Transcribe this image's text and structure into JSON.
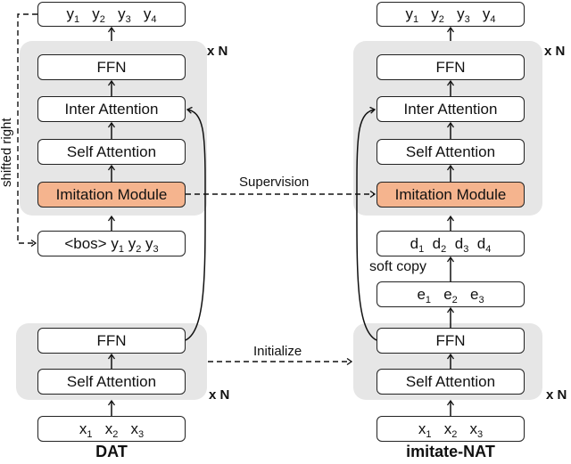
{
  "colors": {
    "panel_bg": "#e6e6e6",
    "imitation_module": "#f5b48e",
    "stroke": "#222222"
  },
  "left": {
    "title": "DAT",
    "output_tokens": [
      [
        "y",
        "1"
      ],
      [
        "y",
        "2"
      ],
      [
        "y",
        "3"
      ],
      [
        "y",
        "4"
      ]
    ],
    "decoder": {
      "repeat": "x N",
      "ffn": "FFN",
      "inter_attention": "Inter Attention",
      "self_attention": "Self Attention",
      "imitation_module": "Imitation Module"
    },
    "decoder_input": {
      "bos": "<bos>",
      "tokens": [
        [
          "y",
          "1"
        ],
        [
          "y",
          "2"
        ],
        [
          "y",
          "3"
        ]
      ]
    },
    "encoder": {
      "repeat": "x N",
      "ffn": "FFN",
      "self_attention": "Self Attention"
    },
    "input_tokens": [
      [
        "x",
        "1"
      ],
      [
        "x",
        "2"
      ],
      [
        "x",
        "3"
      ]
    ],
    "shifted_label": "shifted right"
  },
  "right": {
    "title": "imitate-NAT",
    "output_tokens": [
      [
        "y",
        "1"
      ],
      [
        "y",
        "2"
      ],
      [
        "y",
        "3"
      ],
      [
        "y",
        "4"
      ]
    ],
    "decoder": {
      "repeat": "x N",
      "ffn": "FFN",
      "inter_attention": "Inter Attention",
      "self_attention": "Self Attention",
      "imitation_module": "Imitation Module"
    },
    "decoder_input_tokens": [
      [
        "d",
        "1"
      ],
      [
        "d",
        "2"
      ],
      [
        "d",
        "3"
      ],
      [
        "d",
        "4"
      ]
    ],
    "soft_copy_label": "soft copy",
    "encoder_output_tokens": [
      [
        "e",
        "1"
      ],
      [
        "e",
        "2"
      ],
      [
        "e",
        "3"
      ]
    ],
    "encoder": {
      "repeat": "x N",
      "ffn": "FFN",
      "self_attention": "Self Attention"
    },
    "input_tokens": [
      [
        "x",
        "1"
      ],
      [
        "x",
        "2"
      ],
      [
        "x",
        "3"
      ]
    ]
  },
  "connections": {
    "supervision": "Supervision",
    "initialize": "Initialize"
  }
}
